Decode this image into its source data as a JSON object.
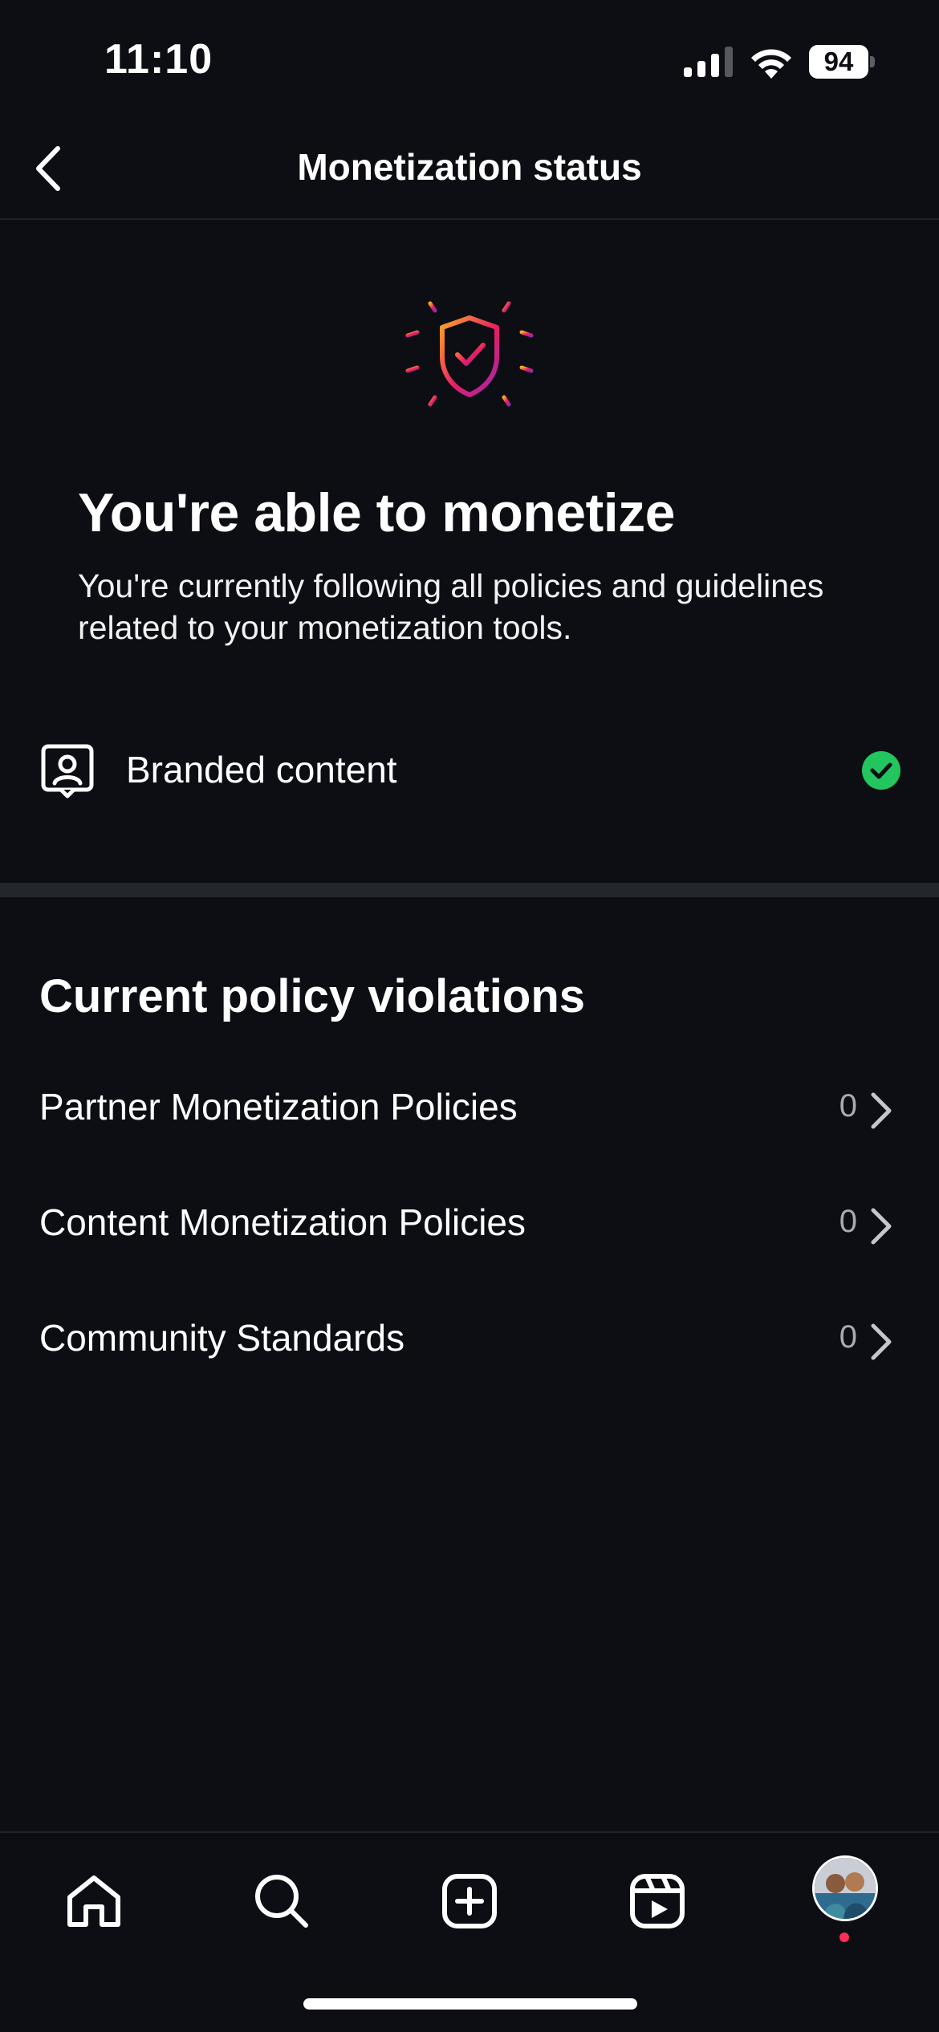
{
  "status_bar": {
    "time": "11:10",
    "battery": "94",
    "icons": [
      "signal-icon",
      "wifi-icon",
      "battery-icon"
    ]
  },
  "nav": {
    "title": "Monetization status",
    "back_icon": "chevron-left-icon"
  },
  "hero": {
    "icon": "shield-check-icon",
    "title": "You're able to monetize",
    "description": "You're currently following all policies and guidelines related to your monetization tools."
  },
  "tools": [
    {
      "label": "Branded content",
      "icon": "branded-content-icon",
      "status_icon": "check-circle-icon",
      "status_color": "#22c55e"
    }
  ],
  "violations": {
    "title": "Current policy violations",
    "items": [
      {
        "label": "Partner Monetization Policies",
        "count": "0"
      },
      {
        "label": "Content Monetization Policies",
        "count": "0"
      },
      {
        "label": "Community Standards",
        "count": "0"
      }
    ]
  },
  "tab_bar": {
    "tabs": [
      "home-icon",
      "search-icon",
      "create-icon",
      "reels-icon",
      "profile-avatar"
    ],
    "notification_dot_color": "#ff2d55"
  },
  "colors": {
    "background": "#0c0e13",
    "divider": "#23262c",
    "gradient": [
      "#f9a825",
      "#e91e63",
      "#9c27b0"
    ]
  }
}
